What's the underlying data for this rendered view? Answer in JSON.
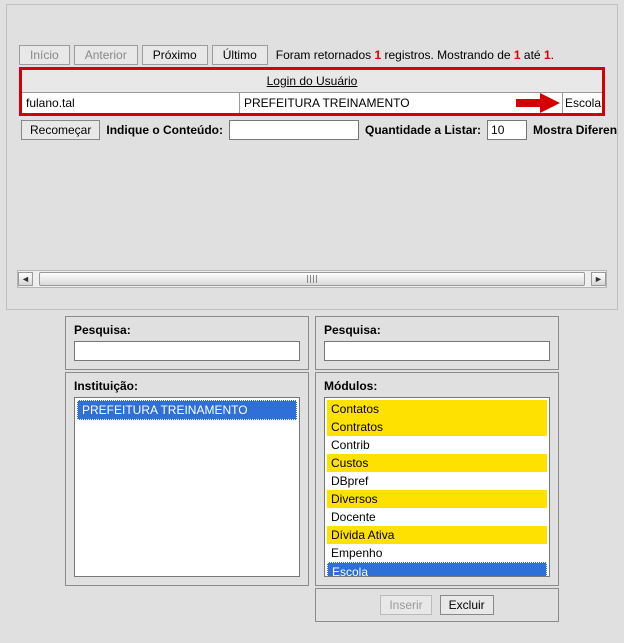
{
  "nav": {
    "inicio": "Início",
    "anterior": "Anterior",
    "proximo": "Próximo",
    "ultimo": "Último",
    "summary_a": "Foram retornados ",
    "reg_count": "1",
    "summary_b": " registros. Mostrando de ",
    "from": "1",
    "summary_c": " até ",
    "to": "1",
    "summary_d": "."
  },
  "table": {
    "header": "Login do Usuário",
    "login": "fulano.tal",
    "institution": "PREFEITURA TREINAMENTO",
    "tail": "Escola"
  },
  "controls": {
    "recomecar": "Recomeçar",
    "indique": "Indique o Conteúdo:",
    "indique_value": "",
    "quant": "Quantidade a Listar:",
    "quant_value": "10",
    "mostra": "Mostra Diferen"
  },
  "search": {
    "left_label": "Pesquisa:",
    "left_value": "",
    "right_label": "Pesquisa:",
    "right_value": ""
  },
  "inst": {
    "label": "Instituição:",
    "items": [
      {
        "text": "PREFEITURA TREINAMENTO",
        "selected": true
      }
    ]
  },
  "mods": {
    "label": "Módulos:",
    "items": [
      {
        "text": "Contatos",
        "yellow": true
      },
      {
        "text": "Contratos",
        "yellow": true
      },
      {
        "text": "Contrib",
        "yellow": false
      },
      {
        "text": "Custos",
        "yellow": true
      },
      {
        "text": "DBpref",
        "yellow": false
      },
      {
        "text": "Diversos",
        "yellow": true
      },
      {
        "text": "Docente",
        "yellow": false
      },
      {
        "text": "Dívida Ativa",
        "yellow": true
      },
      {
        "text": "Empenho",
        "yellow": false
      },
      {
        "text": "Escola",
        "selected": true
      }
    ]
  },
  "actions": {
    "inserir": "Inserir",
    "excluir": "Excluir"
  }
}
